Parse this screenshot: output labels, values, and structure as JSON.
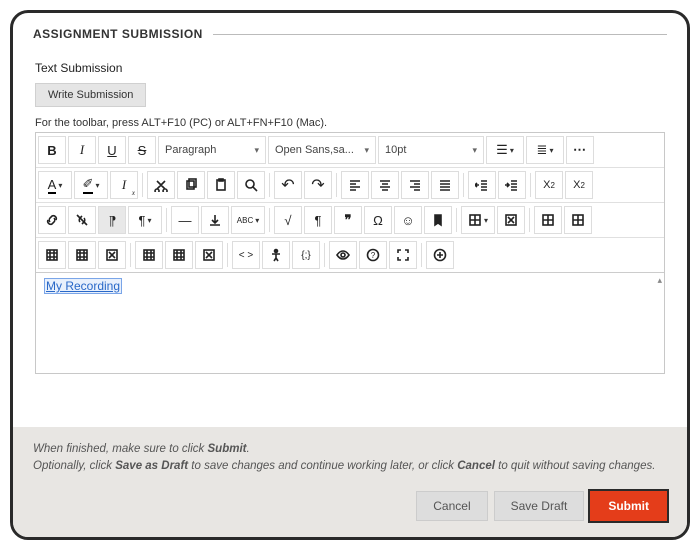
{
  "header": {
    "title": "ASSIGNMENT SUBMISSION"
  },
  "section": {
    "label": "Text Submission",
    "write_button": "Write Submission",
    "toolbar_hint": "For the toolbar, press ALT+F10 (PC) or ALT+FN+F10 (Mac)."
  },
  "toolbar": {
    "paragraph": "Paragraph",
    "font": "Open Sans,sa...",
    "size": "10pt",
    "icons": {
      "bold": "B",
      "italic": "I",
      "underline": "U",
      "strike": "S",
      "bullets": "bullet-list",
      "numbers": "numbered-list",
      "more": "⋯",
      "textcolor": "A",
      "highlight": "✐",
      "clearfmt": "Iₓ",
      "cut": "✂",
      "copy": "⧉",
      "paste": "📋",
      "find": "🔍",
      "undo": "↶",
      "redo": "↷",
      "alignl": "≡",
      "alignc": "≡",
      "alignr": "≡",
      "alignj": "≡",
      "outdent": "⇤",
      "indent": "⇥",
      "sup": "X²",
      "sub": "X₂",
      "link": "🔗",
      "unlink": "⛬",
      "ltr": "¶",
      "rtl": "¶",
      "hr": "—",
      "line": "⟂",
      "spellcheck": "ᴬᴮᶜ",
      "sqrt": "√",
      "para": "¶",
      "quote": "❞",
      "omega": "Ω",
      "emoji": "☺",
      "bookmark": "🔖",
      "table": "⊞",
      "deltable": "⊠",
      "tablel": "⊞",
      "tabler": "⊞",
      "tr1": "⊞",
      "tr2": "⊞",
      "tr3": "⊞",
      "tr4": "⊞",
      "tr5": "⊞",
      "tr6": "⊠",
      "code": "< >",
      "access": "⟂",
      "braces": "{;}",
      "eye": "👁",
      "help": "?",
      "fullscreen": "⛶",
      "plus": "⊕"
    }
  },
  "editor_content": {
    "link_text": "My Recording"
  },
  "footer": {
    "line1_a": "When finished, make sure to click ",
    "line1_b": "Submit",
    "line1_c": ".",
    "line2_a": "Optionally, click ",
    "line2_b": "Save as Draft",
    "line2_c": " to save changes and continue working later, or click ",
    "line2_d": "Cancel",
    "line2_e": " to quit without saving changes.",
    "cancel": "Cancel",
    "savedraft": "Save Draft",
    "submit": "Submit"
  }
}
